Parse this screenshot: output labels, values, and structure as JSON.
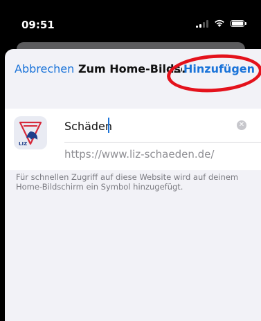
{
  "status_bar": {
    "time": "09:51"
  },
  "nav": {
    "cancel_label": "Abbrechen",
    "title": "Zum Home-Bildschirm",
    "title_ellipsis": "...",
    "add_label": "Hinzufügen"
  },
  "form": {
    "name_value": "Schäden",
    "url": "https://www.liz-schaeden.de/",
    "app_icon_text": "LIZ"
  },
  "footer": {
    "note": "Für schnellen Zugriff auf diese Website wird auf deinem Home-Bildschirm ein Symbol hinzugefügt."
  },
  "colors": {
    "accent": "#1a73d9",
    "highlight": "#e4121c",
    "icon_red": "#d6293a",
    "icon_blue": "#1f3f8a"
  }
}
